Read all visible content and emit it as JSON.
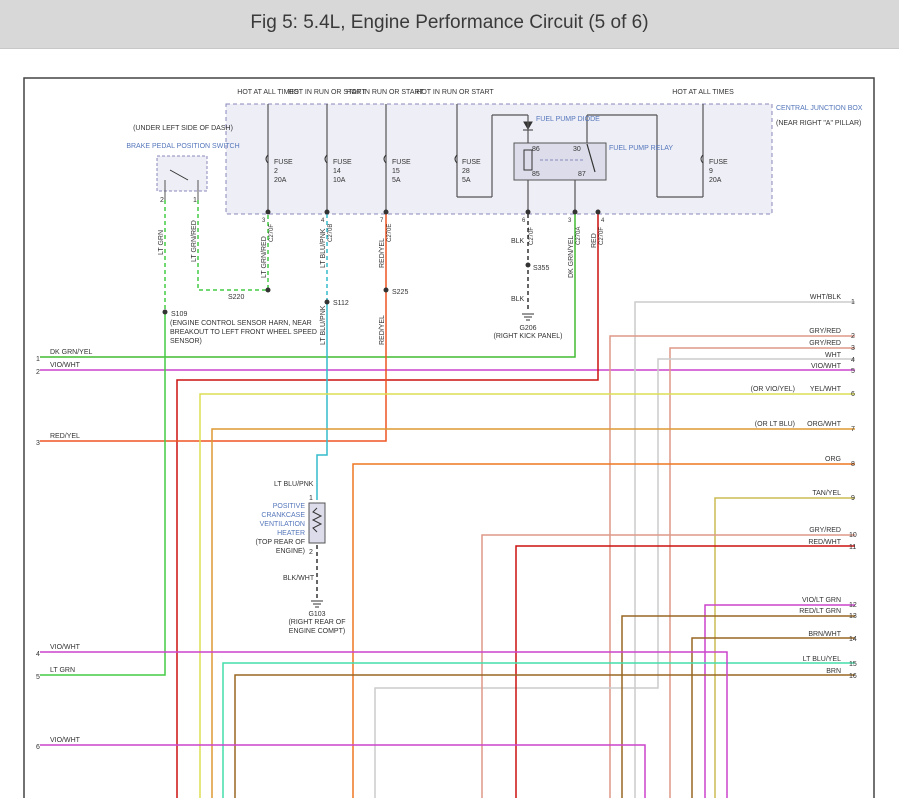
{
  "header": {
    "title": "Fig 5: 5.4L, Engine Performance Circuit (5 of 6)"
  },
  "colors": {
    "dk_grn_yel": "#44bb33",
    "vio_wht": "#cc44cc",
    "red_yel": "#ee5522",
    "lt_grn": "#44cc44",
    "lt_blu_pnk": "#33bbcc",
    "red": "#cc1111",
    "yel_wht": "#dddd55",
    "org_wht": "#dd9933",
    "org": "#ee7722",
    "tan_yel": "#ccbb55",
    "gry_red": "#dd9988",
    "wht": "#cccccc",
    "brn": "#996622",
    "blk": "#333333",
    "box": "#8888bb",
    "label_blue": "#5577bb"
  },
  "junction_box": {
    "title": "CENTRAL JUNCTION BOX",
    "sub": "(NEAR RIGHT \"A\" PILLAR)"
  },
  "power_labels": [
    "HOT AT ALL TIMES",
    "HOT IN RUN OR START",
    "HOT IN RUN OR START",
    "HOT IN RUN OR START",
    "HOT AT ALL TIMES"
  ],
  "fuses": [
    {
      "label": "FUSE",
      "num": "2",
      "amp": "20A"
    },
    {
      "label": "FUSE",
      "num": "14",
      "amp": "10A"
    },
    {
      "label": "FUSE",
      "num": "15",
      "amp": "5A"
    },
    {
      "label": "FUSE",
      "num": "28",
      "amp": "5A"
    },
    {
      "label": "FUSE",
      "num": "9",
      "amp": "20A"
    }
  ],
  "relay": {
    "name": "FUEL PUMP RELAY",
    "diode": "FUEL PUMP DIODE",
    "pins": [
      "86",
      "30",
      "85",
      "87"
    ]
  },
  "brake_switch": {
    "location": "(UNDER LEFT SIDE OF DASH)",
    "name": "BRAKE PEDAL POSITION SWITCH",
    "pins": [
      "2",
      "1"
    ]
  },
  "splices": {
    "s220": "S220",
    "s112": "S112",
    "s225": "S225",
    "s355": "S355",
    "s109": "S109",
    "s109_desc": "(ENGINE CONTROL SENSOR HARN, NEAR BREAKOUT TO LEFT FRONT WHEEL SPEED SENSOR)"
  },
  "grounds": {
    "g206": "G206",
    "g206_desc": "(RIGHT KICK PANEL)",
    "g103": "G103",
    "g103_desc": "(RIGHT REAR OF ENGINE COMPT)"
  },
  "heater": {
    "name": "POSITIVE CRANKCASE VENTILATION HEATER",
    "loc": "(TOP REAR OF ENGINE)",
    "pins": [
      "1",
      "2"
    ]
  },
  "vertical_wire_labels": {
    "lt_grn": "LT GRN",
    "lt_grn_red_a": "LT GRN/RED",
    "lt_grn_red_b": "LT GRN/RED",
    "lt_blu_pnk_a": "LT BLU/PNK",
    "lt_blu_pnk_b": "LT BLU/PNK",
    "red_yel_a": "RED/YEL",
    "red_yel_b": "RED/YEL",
    "blk": "BLK",
    "dk_grn_yel": "DK GRN/YEL",
    "red": "RED"
  },
  "connector_codes": {
    "c1": "C270F",
    "c2": "C270B",
    "c3": "C270E",
    "c4": "C270F",
    "c5": "C270A",
    "c6": "C270F",
    "p1": "3",
    "p2": "4",
    "p3": "7",
    "p4": "6",
    "p5": "3",
    "p6": "4"
  },
  "wire_labels": {
    "blk_a": "BLK",
    "blk_b": "BLK",
    "lt_blu_pnk_h": "LT BLU/PNK",
    "blk_wht": "BLK/WHT"
  },
  "left_wires": [
    {
      "num": "1",
      "label": "DK GRN/YEL"
    },
    {
      "num": "2",
      "label": "VIO/WHT"
    },
    {
      "num": "3",
      "label": "RED/YEL"
    },
    {
      "num": "4",
      "label": "VIO/WHT"
    },
    {
      "num": "5",
      "label": "LT GRN"
    },
    {
      "num": "6",
      "label": "VIO/WHT"
    }
  ],
  "right_wires": [
    {
      "num": "1",
      "label": "WHT/BLK",
      "alt": ""
    },
    {
      "num": "2",
      "label": "GRY/RED",
      "alt": ""
    },
    {
      "num": "3",
      "label": "GRY/RED",
      "alt": ""
    },
    {
      "num": "4",
      "label": "WHT",
      "alt": ""
    },
    {
      "num": "5",
      "label": "VIO/WHT",
      "alt": ""
    },
    {
      "num": "6",
      "label": "YEL/WHT",
      "alt": "(OR VIO/YEL)"
    },
    {
      "num": "7",
      "label": "ORG/WHT",
      "alt": "(OR LT BLU)"
    },
    {
      "num": "8",
      "label": "ORG",
      "alt": ""
    },
    {
      "num": "9",
      "label": "TAN/YEL",
      "alt": ""
    },
    {
      "num": "10",
      "label": "GRY/RED",
      "alt": ""
    },
    {
      "num": "11",
      "label": "RED/WHT",
      "alt": ""
    },
    {
      "num": "12",
      "label": "VIO/LT GRN",
      "alt": ""
    },
    {
      "num": "13",
      "label": "RED/LT GRN",
      "alt": ""
    },
    {
      "num": "14",
      "label": "BRN/WHT",
      "alt": ""
    },
    {
      "num": "15",
      "label": "LT BLU/YEL",
      "alt": ""
    },
    {
      "num": "16",
      "label": "BRN",
      "alt": ""
    }
  ]
}
